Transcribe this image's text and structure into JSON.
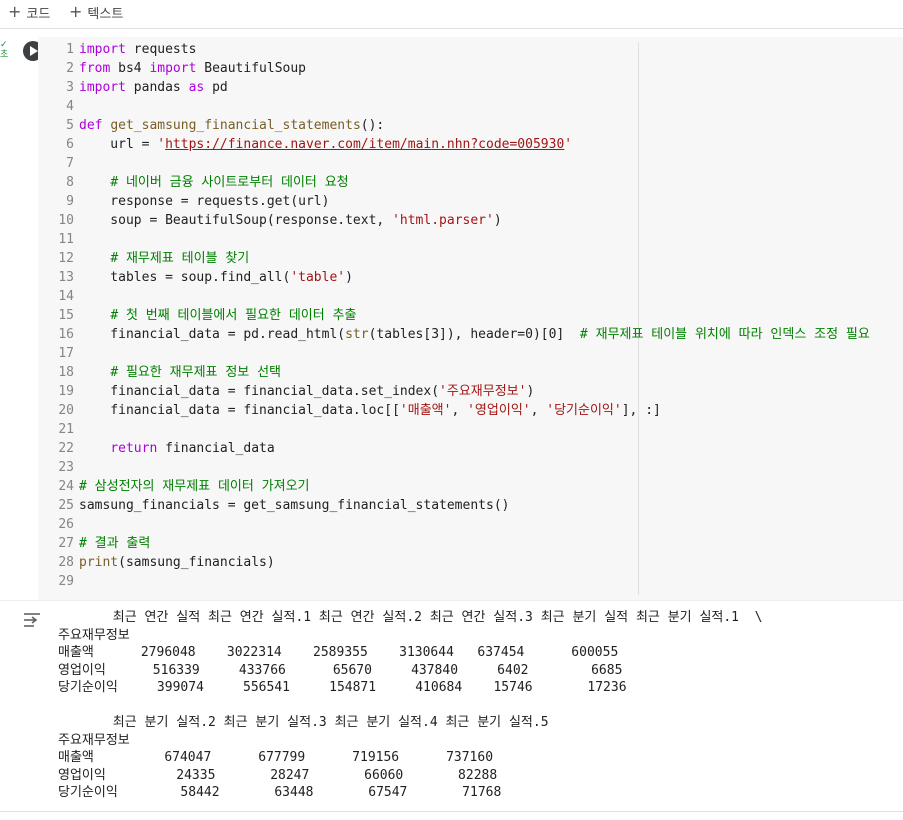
{
  "toolbar": {
    "add_code": "코드",
    "add_text": "텍스트"
  },
  "code_lines": [
    [
      {
        "t": "import",
        "c": "kw"
      },
      {
        "t": " requests"
      }
    ],
    [
      {
        "t": "from",
        "c": "kw"
      },
      {
        "t": " bs4 "
      },
      {
        "t": "import",
        "c": "kw"
      },
      {
        "t": " BeautifulSoup"
      }
    ],
    [
      {
        "t": "import",
        "c": "kw"
      },
      {
        "t": " pandas "
      },
      {
        "t": "as",
        "c": "kw"
      },
      {
        "t": " pd"
      }
    ],
    [],
    [
      {
        "t": "def",
        "c": "kw"
      },
      {
        "t": " "
      },
      {
        "t": "get_samsung_financial_statements",
        "c": "fn"
      },
      {
        "t": "():"
      }
    ],
    [
      {
        "t": "    url = "
      },
      {
        "t": "'",
        "c": "str"
      },
      {
        "t": "https://finance.naver.com/item/main.nhn?code=005930",
        "c": "url"
      },
      {
        "t": "'",
        "c": "str"
      }
    ],
    [],
    [
      {
        "t": "    "
      },
      {
        "t": "# 네이버 금융 사이트로부터 데이터 요청",
        "c": "cm"
      }
    ],
    [
      {
        "t": "    response = requests.get(url)"
      }
    ],
    [
      {
        "t": "    soup = BeautifulSoup(response.text, "
      },
      {
        "t": "'html.parser'",
        "c": "str"
      },
      {
        "t": ")"
      }
    ],
    [],
    [
      {
        "t": "    "
      },
      {
        "t": "# 재무제표 테이블 찾기",
        "c": "cm"
      }
    ],
    [
      {
        "t": "    tables = soup.find_all("
      },
      {
        "t": "'table'",
        "c": "str"
      },
      {
        "t": ")"
      }
    ],
    [],
    [
      {
        "t": "    "
      },
      {
        "t": "# 첫 번째 테이블에서 필요한 데이터 추출",
        "c": "cm"
      }
    ],
    [
      {
        "t": "    financial_data = pd.read_html("
      },
      {
        "t": "str",
        "c": "fn"
      },
      {
        "t": "(tables[3]), header=0)[0]  "
      },
      {
        "t": "# 재무제표 테이블 위치에 따라 인덱스 조정 필요",
        "c": "cm"
      }
    ],
    [],
    [
      {
        "t": "    "
      },
      {
        "t": "# 필요한 재무제표 정보 선택",
        "c": "cm"
      }
    ],
    [
      {
        "t": "    financial_data = financial_data.set_index("
      },
      {
        "t": "'주요재무정보'",
        "c": "str"
      },
      {
        "t": ")"
      }
    ],
    [
      {
        "t": "    financial_data = financial_data.loc[["
      },
      {
        "t": "'매출액'",
        "c": "str"
      },
      {
        "t": ", "
      },
      {
        "t": "'영업이익'",
        "c": "str"
      },
      {
        "t": ", "
      },
      {
        "t": "'당기순이익'",
        "c": "str"
      },
      {
        "t": "], :]"
      }
    ],
    [],
    [
      {
        "t": "    "
      },
      {
        "t": "return",
        "c": "kw"
      },
      {
        "t": " financial_data"
      }
    ],
    [],
    [
      {
        "t": "# 삼성전자의 재무제표 데이터 가져오기",
        "c": "cm"
      }
    ],
    [
      {
        "t": "samsung_financials = get_samsung_financial_statements()"
      }
    ],
    [],
    [
      {
        "t": "# 결과 출력",
        "c": "cm"
      }
    ],
    [
      {
        "t": "print",
        "c": "fn"
      },
      {
        "t": "(samsung_financials)"
      }
    ],
    []
  ],
  "output_lines": [
    "       최근 연간 실적 최근 연간 실적.1 최근 연간 실적.2 최근 연간 실적.3 최근 분기 실적 최근 분기 실적.1  \\",
    "주요재무정보",
    "매출액      2796048    3022314    2589355    3130644   637454      600055",
    "영업이익      516339     433766      65670     437840     6402        6685",
    "당기순이익     399074     556541     154871     410684    15746       17236",
    "",
    "       최근 분기 실적.2 최근 분기 실적.3 최근 분기 실적.4 최근 분기 실적.5",
    "주요재무정보",
    "매출액         674047      677799      719156      737160",
    "영업이익         24335       28247       66060       82288",
    "당기순이익        58442       63448       67547       71768"
  ]
}
